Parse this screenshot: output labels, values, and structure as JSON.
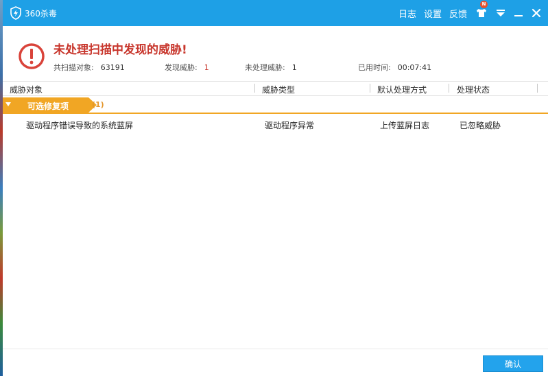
{
  "app": {
    "title": "360杀毒"
  },
  "titlebar": {
    "log_label": "日志",
    "settings_label": "设置",
    "feedback_label": "反馈",
    "notification_badge": "N"
  },
  "summary": {
    "headline": "未处理扫描中发现的威胁!",
    "scanned_label": "共扫描对象:",
    "scanned_value": "63191",
    "found_label": "发现威胁:",
    "found_value": "1",
    "unhandled_label": "未处理威胁:",
    "unhandled_value": "1",
    "elapsed_label": "已用时间:",
    "elapsed_value": "00:07:41"
  },
  "table": {
    "columns": [
      "威胁对象",
      "威胁类型",
      "默认处理方式",
      "处理状态"
    ],
    "group": {
      "label": "可选修复项",
      "count": "(1)"
    },
    "rows": [
      {
        "object": "驱动程序错误导致的系统蓝屏",
        "type": "驱动程序异常",
        "action": "上传蓝屏日志",
        "status": "已忽略威胁"
      }
    ]
  },
  "footer": {
    "confirm_label": "确认"
  },
  "colors": {
    "titlebar": "#1ea0e6",
    "accent_orange": "#f1a624",
    "alert_red": "#c8372d",
    "button_blue": "#23a3ec"
  },
  "icons": {
    "app": "shield-lightning-icon",
    "skin": "tshirt-icon",
    "menu": "menu-down-icon",
    "minimize": "minimize-icon",
    "close": "close-icon",
    "warning": "exclamation-circle-icon"
  }
}
